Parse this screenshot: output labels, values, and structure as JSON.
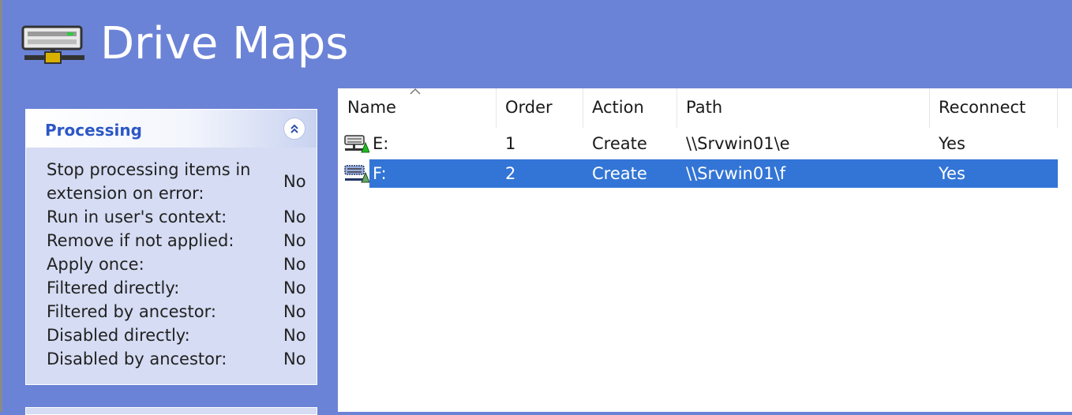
{
  "header": {
    "title": "Drive Maps",
    "icon": "drive-map-icon"
  },
  "panel": {
    "title": "Processing",
    "collapse_icon": "double-chevron-up-icon",
    "properties": [
      {
        "label": "Stop processing items in",
        "label2": "extension on error:",
        "value": "No"
      },
      {
        "label": "Run in user's context:",
        "value": "No"
      },
      {
        "label": "Remove if not applied:",
        "value": "No"
      },
      {
        "label": "Apply once:",
        "value": "No"
      },
      {
        "label": "Filtered directly:",
        "value": "No"
      },
      {
        "label": "Filtered by ancestor:",
        "value": "No"
      },
      {
        "label": "Disabled directly:",
        "value": "No"
      },
      {
        "label": "Disabled by ancestor:",
        "value": "No"
      }
    ]
  },
  "table": {
    "columns": [
      "Name",
      "Order",
      "Action",
      "Path",
      "Reconnect"
    ],
    "sorted_column": "Name",
    "rows": [
      {
        "name": "E:",
        "order": "1",
        "action": "Create",
        "path": "\\\\Srvwin01\\e",
        "reconnect": "Yes",
        "selected": false
      },
      {
        "name": "F:",
        "order": "2",
        "action": "Create",
        "path": "\\\\Srvwin01\\f",
        "reconnect": "Yes",
        "selected": true
      }
    ]
  },
  "colors": {
    "background": "#6b83d6",
    "selection": "#3375d6",
    "panel": "#d5dcf3",
    "panel_title": "#2d57c6"
  }
}
